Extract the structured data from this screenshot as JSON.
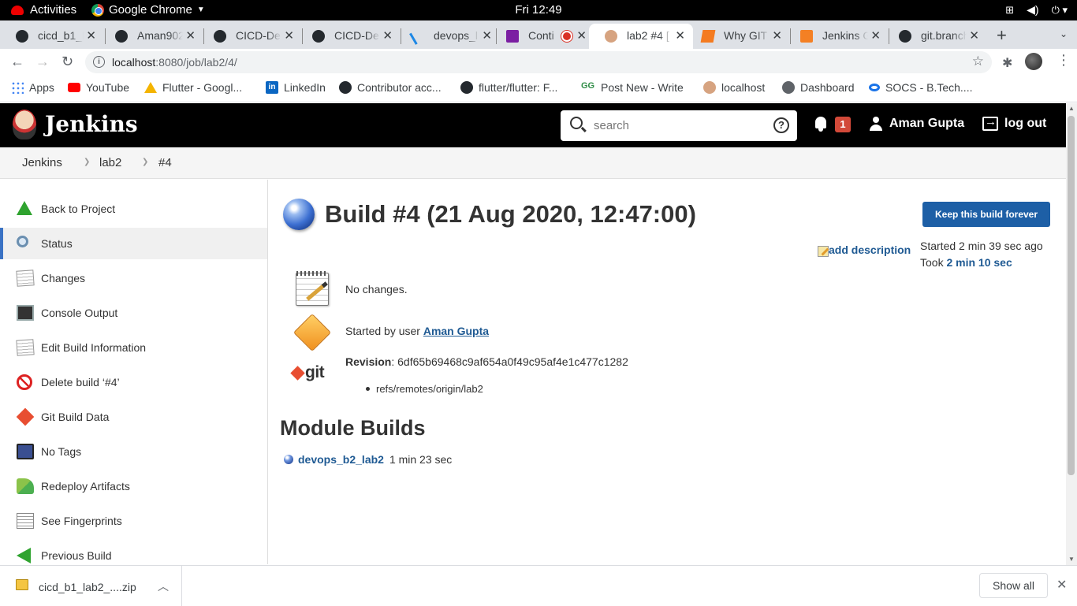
{
  "system_bar": {
    "activities": "Activities",
    "app_name": "Google Chrome",
    "clock": "Fri 12:49"
  },
  "tabs": [
    {
      "title": "cicd_b1_l",
      "icon": "github-icon"
    },
    {
      "title": "Aman902",
      "icon": "github-icon"
    },
    {
      "title": "CICD-De",
      "icon": "github-icon"
    },
    {
      "title": "CICD-De",
      "icon": "github-icon"
    },
    {
      "title": "devops_l",
      "icon": "devops-icon"
    },
    {
      "title": "Conti",
      "icon": "continuous-icon",
      "recording": true
    },
    {
      "title": "lab2 #4 [",
      "icon": "jenkins-icon",
      "active": true
    },
    {
      "title": "Why GIT",
      "icon": "why-icon"
    },
    {
      "title": "Jenkins G",
      "icon": "stackoverflow-icon"
    },
    {
      "title": "git.branch",
      "icon": "github-icon"
    }
  ],
  "address_bar": {
    "url_host": "localhost",
    "url_path": ":8080/job/lab2/4/"
  },
  "bookmarks": [
    {
      "label": "Apps",
      "icon": "apps-icon"
    },
    {
      "label": "YouTube",
      "icon": "youtube-icon"
    },
    {
      "label": "Flutter - Googl...",
      "icon": "drive-icon"
    },
    {
      "label": "LinkedIn",
      "icon": "linkedin-icon"
    },
    {
      "label": "Contributor acc...",
      "icon": "github-icon"
    },
    {
      "label": "flutter/flutter: F...",
      "icon": "github-icon"
    },
    {
      "label": "Post New - Write",
      "icon": "gfg-icon"
    },
    {
      "label": "localhost",
      "icon": "jenkins-icon"
    },
    {
      "label": "Dashboard",
      "icon": "globe-icon"
    },
    {
      "label": "SOCS - B.Tech....",
      "icon": "socs-icon"
    }
  ],
  "jenkins_header": {
    "title": "Jenkins",
    "search_placeholder": "search",
    "notification_count": "1",
    "user_name": "Aman Gupta",
    "logout": "log out"
  },
  "breadcrumb": [
    "Jenkins",
    "lab2",
    "#4"
  ],
  "side_tasks": [
    {
      "label": "Back to Project",
      "icon": "up-arrow-icon"
    },
    {
      "label": "Status",
      "icon": "magnifier-icon",
      "selected": true
    },
    {
      "label": "Changes",
      "icon": "notepad-icon"
    },
    {
      "label": "Console Output",
      "icon": "terminal-icon"
    },
    {
      "label": "Edit Build Information",
      "icon": "notepad-icon"
    },
    {
      "label": "Delete build ‘#4’",
      "icon": "no-entry-icon"
    },
    {
      "label": "Git Build Data",
      "icon": "git-icon"
    },
    {
      "label": "No Tags",
      "icon": "floppy-icon"
    },
    {
      "label": "Redeploy Artifacts",
      "icon": "redeploy-icon"
    },
    {
      "label": "See Fingerprints",
      "icon": "fingerprint-icon"
    },
    {
      "label": "Previous Build",
      "icon": "left-arrow-icon"
    }
  ],
  "build": {
    "title": "Build #4 (21 Aug 2020, 12:47:00)",
    "keep_button": "Keep this build forever",
    "add_description": "add description",
    "started": "Started 2 min 39 sec ago",
    "took_prefix": "Took ",
    "took_value": "2 min 10 sec",
    "no_changes": "No changes.",
    "started_by_prefix": "Started by user ",
    "started_by_user": "Aman Gupta",
    "revision_label": "Revision",
    "revision_value": ": 6df65b69468c9af654a0f49c95af4e1c477c1282",
    "git_logo_text": "git",
    "ref": "refs/remotes/origin/lab2",
    "status_color": "#3c6fd1"
  },
  "module_builds": {
    "heading": "Module Builds",
    "items": [
      {
        "name": "devops_b2_lab2",
        "duration": "1 min 23 sec"
      }
    ]
  },
  "download_bar": {
    "filename": "cicd_b1_lab2_....zip",
    "show_all": "Show all"
  }
}
